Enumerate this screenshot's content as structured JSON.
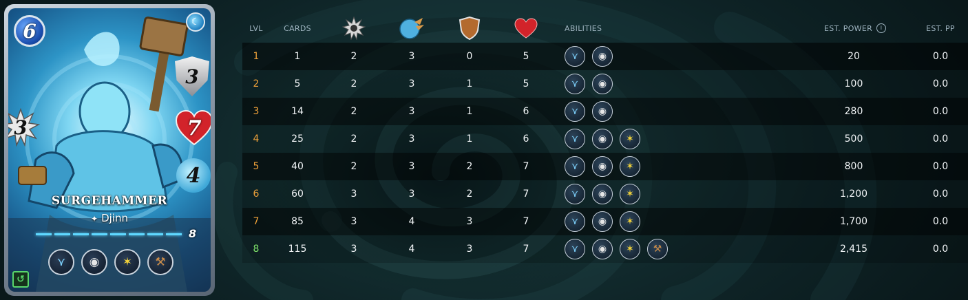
{
  "card": {
    "name": "SURGEHAMMER",
    "type": "Djinn",
    "mana": "6",
    "armor": "3",
    "health": "7",
    "speed": "4",
    "attack": "3",
    "level": "8",
    "element_icon": "water-element-icon",
    "abilities": [
      "flying-icon",
      "true-strike-icon",
      "stun-icon",
      "hammer-icon"
    ],
    "edition_icon": "edition-badge-icon"
  },
  "table": {
    "headers": {
      "lvl": "LVL",
      "cards": "CARDS",
      "attack_icon": "melee-attack-icon",
      "speed_icon": "speed-icon",
      "armor_icon": "armor-shield-icon",
      "health_icon": "health-heart-icon",
      "abilities": "ABILITIES",
      "est_power": "EST. POWER",
      "est_pp": "EST. PP"
    },
    "rows": [
      {
        "lvl": "1",
        "cards": "1",
        "attack": "2",
        "speed": "3",
        "armor": "0",
        "health": "5",
        "abilities": [
          "flying-icon",
          "true-strike-icon"
        ],
        "power": "20",
        "pp": "0.0"
      },
      {
        "lvl": "2",
        "cards": "5",
        "attack": "2",
        "speed": "3",
        "armor": "1",
        "health": "5",
        "abilities": [
          "flying-icon",
          "true-strike-icon"
        ],
        "power": "100",
        "pp": "0.0"
      },
      {
        "lvl": "3",
        "cards": "14",
        "attack": "2",
        "speed": "3",
        "armor": "1",
        "health": "6",
        "abilities": [
          "flying-icon",
          "true-strike-icon"
        ],
        "power": "280",
        "pp": "0.0"
      },
      {
        "lvl": "4",
        "cards": "25",
        "attack": "2",
        "speed": "3",
        "armor": "1",
        "health": "6",
        "abilities": [
          "flying-icon",
          "true-strike-icon",
          "stun-icon"
        ],
        "power": "500",
        "pp": "0.0"
      },
      {
        "lvl": "5",
        "cards": "40",
        "attack": "2",
        "speed": "3",
        "armor": "2",
        "health": "7",
        "abilities": [
          "flying-icon",
          "true-strike-icon",
          "stun-icon"
        ],
        "power": "800",
        "pp": "0.0"
      },
      {
        "lvl": "6",
        "cards": "60",
        "attack": "3",
        "speed": "3",
        "armor": "2",
        "health": "7",
        "abilities": [
          "flying-icon",
          "true-strike-icon",
          "stun-icon"
        ],
        "power": "1,200",
        "pp": "0.0"
      },
      {
        "lvl": "7",
        "cards": "85",
        "attack": "3",
        "speed": "4",
        "armor": "3",
        "health": "7",
        "abilities": [
          "flying-icon",
          "true-strike-icon",
          "stun-icon"
        ],
        "power": "1,700",
        "pp": "0.0"
      },
      {
        "lvl": "8",
        "cards": "115",
        "attack": "3",
        "speed": "4",
        "armor": "3",
        "health": "7",
        "abilities": [
          "flying-icon",
          "true-strike-icon",
          "stun-icon",
          "hammer-icon"
        ],
        "power": "2,415",
        "pp": "0.0"
      }
    ]
  },
  "colors": {
    "level_normal": "#f0a23a",
    "level_max": "#7ee36a",
    "accent_water": "#3fa8d8"
  }
}
